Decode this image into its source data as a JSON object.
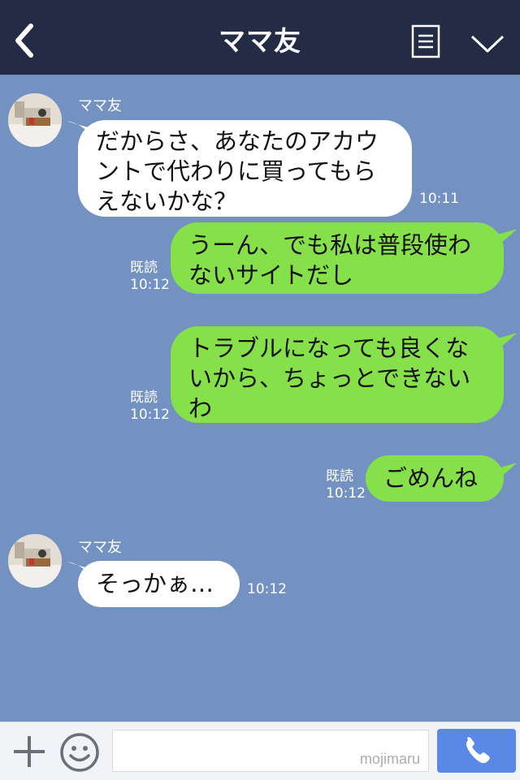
{
  "header": {
    "title": "ママ友",
    "back_icon": "chevron-left-icon",
    "menu_icon": "notes-icon",
    "collapse_icon": "chevron-down-icon"
  },
  "messages": [
    {
      "side": "in",
      "sender": "ママ友",
      "text_lines": [
        "だからさ、あなたのアカウ",
        "ントで代わりに買ってもら",
        "えないかな？"
      ],
      "time": "10:11"
    },
    {
      "side": "out",
      "read": "既読",
      "text_lines": [
        "うーん、でも私は普段使わ",
        "ないサイトだし"
      ],
      "time": "10:12"
    },
    {
      "side": "out",
      "read": "既読",
      "text_lines": [
        "トラブルになっても良くな",
        "いから、ちょっとできない",
        "わ"
      ],
      "time": "10:12"
    },
    {
      "side": "out",
      "read": "既読",
      "text_lines": [
        "ごめんね"
      ],
      "time": "10:12"
    },
    {
      "side": "in",
      "sender": "ママ友",
      "text_lines": [
        "そっかぁ…"
      ],
      "time": "10:12"
    }
  ],
  "input_bar": {
    "watermark": "mojimaru",
    "plus_icon": "plus-icon",
    "emoji_icon": "smiley-icon",
    "call_icon": "phone-icon"
  },
  "colors": {
    "background": "#7392c2",
    "header": "#232c44",
    "out_bubble": "#85e049",
    "in_bubble": "#ffffff",
    "call_button": "#5a88e6"
  }
}
